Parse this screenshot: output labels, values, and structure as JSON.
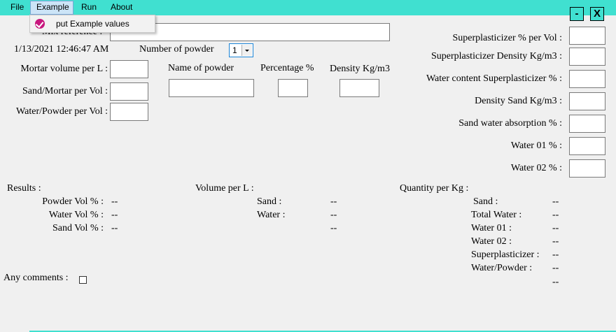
{
  "menu": {
    "file": "File",
    "example": "Example",
    "run": "Run",
    "about": "About"
  },
  "dropdown": {
    "put_example_values": "put Example values"
  },
  "window_buttons": {
    "minimize": "-",
    "close": "X"
  },
  "mix_reference_label": "Mix reference :",
  "timestamp": "1/13/2021 12:46:47 AM",
  "number_of_powder": {
    "label": "Number of powder",
    "value": "1"
  },
  "inputs_left": {
    "mortar_volume": "Mortar volume per L :",
    "sand_mortar": "Sand/Mortar per Vol :",
    "water_powder": "Water/Powder per Vol :"
  },
  "powder_table": {
    "name": "Name of powder",
    "percentage": "Percentage %",
    "density": "Density Kg/m3"
  },
  "inputs_right": {
    "sp_percent": "Superplasticizer % per Vol :",
    "sp_density": "Superplasticizer Density Kg/m3 :",
    "water_sp": "Water content Superplasticizer % :",
    "density_sand": "Density Sand Kg/m3 :",
    "sand_absorption": "Sand water absorption % :",
    "water01": "Water 01 % :",
    "water02": "Water 02 % :"
  },
  "results": {
    "title": "Results :",
    "powder_vol": "Powder Vol % :",
    "water_vol": "Water Vol % :",
    "sand_vol": "Sand Vol % :",
    "powder_val": "--",
    "water_val": "--",
    "sand_val": "--"
  },
  "volume": {
    "title": "Volume per L :",
    "sand": "Sand :",
    "water": "Water :",
    "sand_val": "--",
    "water_val": "--",
    "extra_val": "--"
  },
  "quantity": {
    "title": "Quantity per Kg :",
    "sand": "Sand :",
    "total_water": "Total Water :",
    "water01": "Water 01 :",
    "water02": "Water 02 :",
    "superplasticizer": "Superplasticizer :",
    "water_powder": "Water/Powder :",
    "sand_val": "--",
    "total_water_val": "--",
    "water01_val": "--",
    "water02_val": "--",
    "sp_val": "--",
    "wp_val": "--",
    "extra_val": "--"
  },
  "comments_label": "Any comments :"
}
